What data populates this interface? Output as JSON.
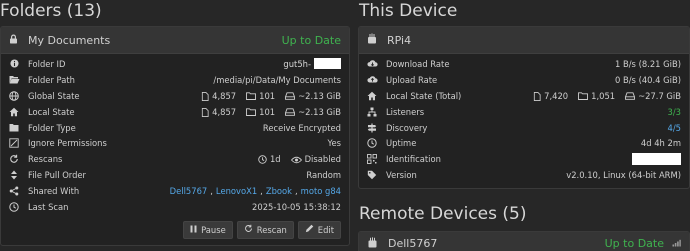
{
  "folders": {
    "heading": "Folders (13)",
    "panel": {
      "title": "My Documents",
      "status": "Up to Date",
      "rows": [
        {
          "icon": "folder-id-icon",
          "label": "Folder ID",
          "value": "gut5h-"
        },
        {
          "icon": "folder-open-icon",
          "label": "Folder Path",
          "value": "/media/pi/Data/My Documents"
        },
        {
          "icon": "globe-icon",
          "label": "Global State",
          "files": "4,857",
          "dirs": "101",
          "size": "~2.13 GiB"
        },
        {
          "icon": "home-icon",
          "label": "Local State",
          "files": "4,857",
          "dirs": "101",
          "size": "~2.13 GiB"
        },
        {
          "icon": "folder-icon",
          "label": "Folder Type",
          "value": "Receive Encrypted"
        },
        {
          "icon": "filter-icon",
          "label": "Ignore Permissions",
          "value": "Yes"
        },
        {
          "icon": "refresh-icon",
          "label": "Rescans",
          "interval": "1d",
          "watcher": "Disabled"
        },
        {
          "icon": "sort-icon",
          "label": "File Pull Order",
          "value": "Random"
        },
        {
          "icon": "share-icon",
          "label": "Shared With",
          "devices": [
            "Dell5767",
            "LenovoX1",
            "Zbook",
            "moto g84"
          ]
        },
        {
          "icon": "clock-icon",
          "label": "Last Scan",
          "value": "2025-10-05 15:38:12"
        }
      ],
      "buttons": {
        "pause": "Pause",
        "rescan": "Rescan",
        "edit": "Edit"
      }
    }
  },
  "device": {
    "heading": "This Device",
    "panel": {
      "title": "RPi4",
      "rows": [
        {
          "icon": "cloud-download-icon",
          "label": "Download Rate",
          "value": "1 B/s (8.21 GiB)"
        },
        {
          "icon": "cloud-upload-icon",
          "label": "Upload Rate",
          "value": "0 B/s (40.4 GiB)"
        },
        {
          "icon": "home-icon",
          "label": "Local State (Total)",
          "files": "7,420",
          "dirs": "1,051",
          "size": "~27.7 GiB"
        },
        {
          "icon": "network-icon",
          "label": "Listeners",
          "value": "3/3"
        },
        {
          "icon": "signpost-icon",
          "label": "Discovery",
          "value": "4/5"
        },
        {
          "icon": "clock-icon",
          "label": "Uptime",
          "value": "4d 4h 2m"
        },
        {
          "icon": "qrcode-icon",
          "label": "Identification",
          "value": ""
        },
        {
          "icon": "tag-icon",
          "label": "Version",
          "value": "v2.0.10, Linux (64-bit ARM)"
        }
      ]
    }
  },
  "remote": {
    "heading": "Remote Devices (5)",
    "panel": {
      "title": "Dell5767",
      "status": "Up to Date"
    }
  },
  "colors": {
    "accent_green": "#3fb34f",
    "link_blue": "#55a8e8",
    "background": "#272727"
  }
}
